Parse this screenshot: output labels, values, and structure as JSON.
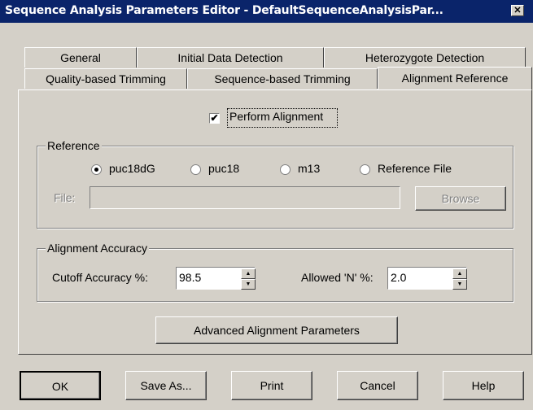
{
  "window": {
    "title": "Sequence Analysis Parameters Editor - DefaultSequenceAnalysisPar...",
    "close_glyph": "✕"
  },
  "tabs": {
    "row1": [
      "General",
      "Initial Data Detection",
      "Heterozygote Detection"
    ],
    "row2": [
      "Quality-based Trimming",
      "Sequence-based Trimming",
      "Alignment Reference"
    ],
    "active": "Alignment Reference"
  },
  "perform_alignment": {
    "label": "Perform Alignment",
    "checked": true
  },
  "reference": {
    "legend": "Reference",
    "options": [
      {
        "label": "puc18dG",
        "selected": true
      },
      {
        "label": "puc18",
        "selected": false
      },
      {
        "label": "m13",
        "selected": false
      },
      {
        "label": "Reference File",
        "selected": false
      }
    ],
    "file_label": "File:",
    "file_value": "",
    "browse_label": "Browse"
  },
  "accuracy": {
    "legend": "Alignment Accuracy",
    "cutoff_label": "Cutoff Accuracy %:",
    "cutoff_value": "98.5",
    "allowed_n_label": "Allowed 'N' %:",
    "allowed_n_value": "2.0"
  },
  "advanced_button": "Advanced Alignment Parameters",
  "footer": {
    "ok": "OK",
    "save_as": "Save As...",
    "print": "Print",
    "cancel": "Cancel",
    "help": "Help"
  },
  "colors": {
    "titlebar": "#0a246a",
    "face": "#d4d0c8"
  }
}
